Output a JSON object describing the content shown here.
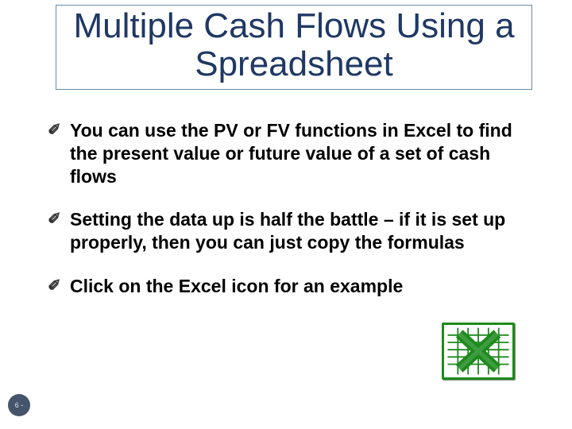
{
  "title": "Multiple Cash Flows Using a Spreadsheet",
  "bullets": [
    "You can use the PV or FV functions in Excel to find the present value or future value of a set of cash flows",
    "Setting the data up is half the battle – if it is set up properly, then you can just copy the formulas",
    "Click on the Excel icon for an example"
  ],
  "icon_name": "excel-icon",
  "slide_number": "6 -"
}
